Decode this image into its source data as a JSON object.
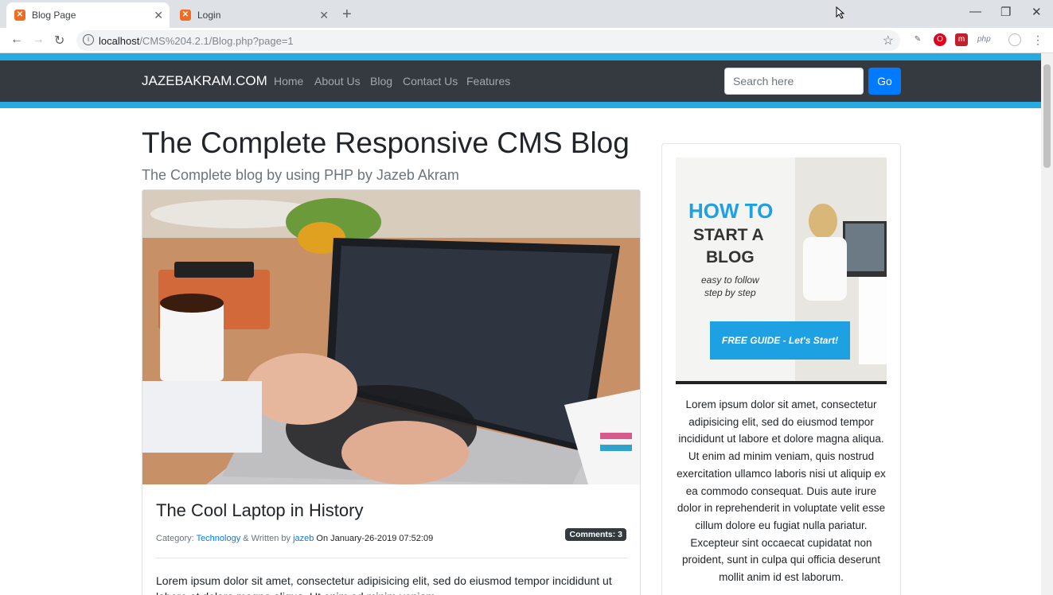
{
  "browser": {
    "tabs": [
      {
        "title": "Blog Page",
        "active": true
      },
      {
        "title": "Login",
        "active": false
      }
    ],
    "url_host": "localhost",
    "url_path": "/CMS%204.2.1/Blog.php?page=1"
  },
  "navbar": {
    "brand": "JAZEBAKRAM.COM",
    "links": [
      "Home",
      "About Us",
      "Blog",
      "Contact Us",
      "Features"
    ],
    "search_placeholder": "Search here",
    "go_label": "Go"
  },
  "header": {
    "title": "The Complete Responsive CMS Blog",
    "subtitle": "The Complete blog by using PHP by Jazeb Akram"
  },
  "post": {
    "title": "The Cool Laptop in History",
    "category_prefix": "Category:",
    "category": "Technology",
    "written_by": "& Written by",
    "author": "jazeb",
    "on": "On",
    "date": "January-26-2019 07:52:09",
    "comments_badge": "Comments: 3",
    "excerpt": "Lorem ipsum dolor sit amet, consectetur adipisicing elit, sed do eiusmod tempor incididunt ut labore et dolore magna aliqua. Ut enim ad minim veniam"
  },
  "sidebar": {
    "ad": {
      "line1": "HOW TO",
      "line2": "START A",
      "line3": "BLOG",
      "sub1": "easy to follow",
      "sub2": "step by step",
      "button": "FREE GUIDE - Let's Start!"
    },
    "text": "Lorem ipsum dolor sit amet, consectetur adipisicing elit, sed do eiusmod tempor incididunt ut labore et dolore magna aliqua. Ut enim ad minim veniam, quis nostrud exercitation ullamco laboris nisi ut aliquip ex ea commodo consequat. Duis aute irure dolor in reprehenderit in voluptate velit esse cillum dolore eu fugiat nulla pariatur. Excepteur sint occaecat cupidatat non proident, sunt in culpa qui officia deserunt mollit anim id est laborum."
  },
  "colors": {
    "accent": "#27aae1",
    "navbar": "#343a40",
    "primary": "#007bff"
  }
}
